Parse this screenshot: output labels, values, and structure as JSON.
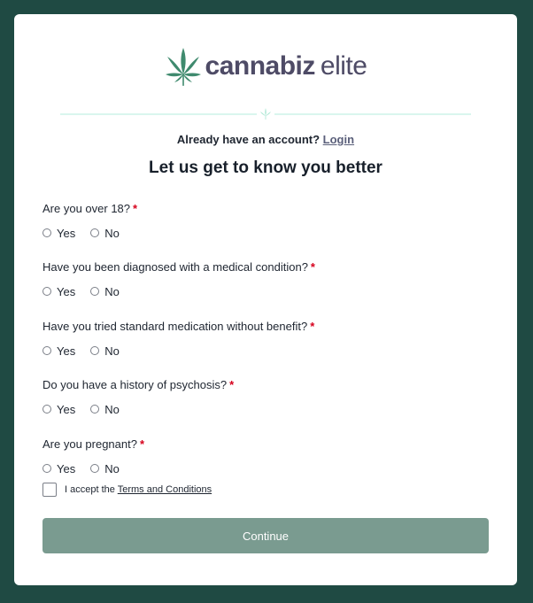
{
  "brand": {
    "name_bold": "cannabiz",
    "name_light": "elite",
    "accent": "#3f8a6e",
    "text_color": "#4e4b66"
  },
  "account": {
    "prompt": "Already have an account?",
    "login_label": "Login"
  },
  "heading": "Let us get to know you better",
  "questions": [
    {
      "label": "Are you over 18?",
      "required": "*",
      "options": [
        "Yes",
        "No"
      ]
    },
    {
      "label": "Have you been diagnosed with a medical condition?",
      "required": "*",
      "options": [
        "Yes",
        "No"
      ]
    },
    {
      "label": "Have you tried standard medication without benefit?",
      "required": "*",
      "options": [
        "Yes",
        "No"
      ]
    },
    {
      "label": "Do you have a history of psychosis?",
      "required": "*",
      "options": [
        "Yes",
        "No"
      ]
    },
    {
      "label": "Are you pregnant?",
      "required": "*",
      "options": [
        "Yes",
        "No"
      ]
    }
  ],
  "terms": {
    "prefix": "I accept the",
    "link_label": "Terms and Conditions",
    "checked": false
  },
  "continue_label": "Continue",
  "colors": {
    "background": "#1f4a43",
    "button": "#7a9b90",
    "required": "#d6001c",
    "divider": "#d9f6ee"
  }
}
